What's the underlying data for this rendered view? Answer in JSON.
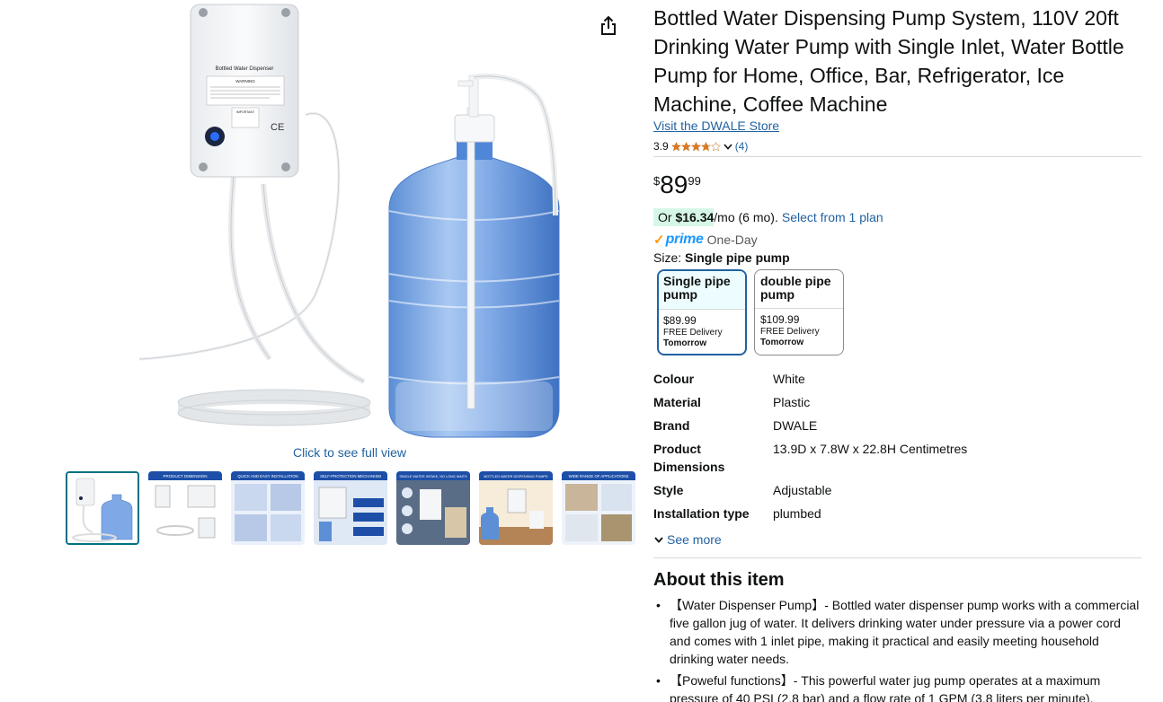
{
  "gallery": {
    "full_view_label": "Click to see full view",
    "thumbnails": [
      {
        "label": "",
        "theme": "product"
      },
      {
        "label": "PRODUCT DIMENSION",
        "theme": "blue"
      },
      {
        "label": "QUICK AND EASY INSTALLATION",
        "theme": "blue"
      },
      {
        "label": "SELF-PROTECTION MECHANISM",
        "theme": "blue"
      },
      {
        "label": "SINGLE WATER INTAKE, NO LONG WAITS",
        "theme": "blue"
      },
      {
        "label": "BOTTLED WATER DISPENSING PUMPS",
        "theme": "blue"
      },
      {
        "label": "WIDE RANGE OF APPLICATIONS",
        "theme": "blue"
      }
    ],
    "pump_box_label": "Bottled Water Dispenser",
    "pump_warning_label": "WARNING",
    "pump_important_label": "IMPORTANT",
    "pump_ce_mark": "CE"
  },
  "product": {
    "title": "Bottled Water Dispensing Pump System, 110V 20ft Drinking Water Pump with Single Inlet, Water Bottle Pump for Home, Office, Bar, Refrigerator, Ice Machine, Coffee Machine",
    "store_link": "Visit the DWALE Store",
    "rating": "3.9",
    "rating_value": 3.9,
    "review_count": "(4)",
    "price_symbol": "$",
    "price_whole": "89",
    "price_fraction": "99",
    "monthly_prefix": "Or ",
    "monthly_amount": "$16.34",
    "monthly_suffix": "/mo (6 mo).",
    "monthly_link": "Select from 1 plan",
    "prime_label": "prime",
    "prime_delivery": "One-Day",
    "size_label": "Size: ",
    "size_selected": "Single pipe pump"
  },
  "size_options": [
    {
      "name": "Single pipe pump",
      "price": "$89.99",
      "delivery": "FREE Delivery",
      "when": "Tomorrow",
      "selected": true
    },
    {
      "name": "double pipe pump",
      "price": "$109.99",
      "delivery": "FREE Delivery",
      "when": "Tomorrow",
      "selected": false
    }
  ],
  "specs": [
    {
      "key": "Colour",
      "value": "White"
    },
    {
      "key": "Material",
      "value": "Plastic"
    },
    {
      "key": "Brand",
      "value": "DWALE"
    },
    {
      "key": "Product Dimensions",
      "value": "13.9D x 7.8W x 22.8H Centimetres"
    },
    {
      "key": "Style",
      "value": "Adjustable"
    },
    {
      "key": "Installation type",
      "value": "plumbed"
    }
  ],
  "see_more": "See more",
  "about": {
    "title": "About this item",
    "bullets": [
      "【Water Dispenser Pump】- Bottled water dispenser pump works with a commercial five gallon jug of water. It delivers drinking water under pressure via a power cord and comes with 1 inlet pipe, making it practical and easily meeting household drinking water needs.",
      "【Poweful functions】- This powerful water jug pump operates at a maximum pressure of 40 PSI (2.8 bar) and a flow rate of 1 GPM (3.8 liters per minute)."
    ]
  },
  "colors": {
    "link": "#2162A1",
    "selected_border": "#2162A1",
    "thumb_selected": "#007185",
    "star": "#DE7921",
    "prime_check": "#F59B17",
    "prime_word": "#1A98FF",
    "monthly_bg": "#D7F7E6"
  }
}
